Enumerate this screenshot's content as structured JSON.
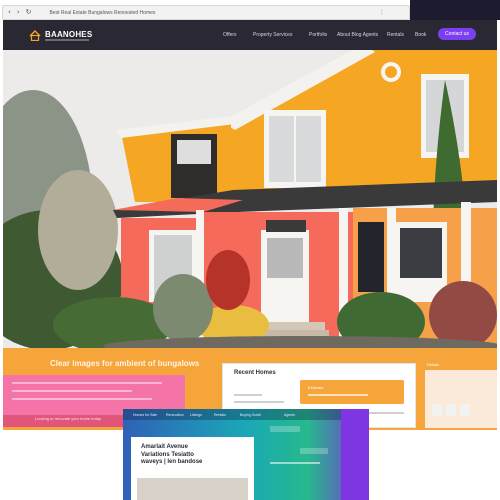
{
  "browser": {
    "url": "Best Real Estate Bungalows Renovated Homes",
    "back_icon": "back-arrow-icon",
    "forward_icon": "forward-arrow-icon",
    "refresh_icon": "refresh-icon",
    "back_glyph": "‹",
    "forward_glyph": "›",
    "refresh_glyph": "↻",
    "menu_glyph": "⋮"
  },
  "site": {
    "logo": "BAANOHES",
    "nav": [
      "Offers",
      "Property Services",
      "Portfolio",
      "About Blog Agents",
      "Rentals",
      "Book"
    ],
    "cta": "Contact us"
  },
  "hero": {
    "house_color": "#f5a623",
    "trim_color": "#ff6b4a"
  },
  "band": {
    "heading": "Clear images for ambient of bungalows",
    "pink_footer": "Looking to renovate your home today"
  },
  "panel": {
    "title": "Recent Homes",
    "button": "Estimate"
  },
  "right_cards": {
    "label": "Details"
  },
  "gradient_card": {
    "tabs": [
      "Homes for Sale",
      "Renovation",
      "Listings",
      "Rentals",
      "Buying Guide",
      "Agents"
    ],
    "heading": "Amarlait Avenue\nVariations Tesiatto\nwaveys | Ien bandose"
  },
  "colors": {
    "nav_bg": "#2a2933",
    "accent": "#7b3ff2",
    "band": "#f6a53a",
    "pink": "#f474a8"
  }
}
